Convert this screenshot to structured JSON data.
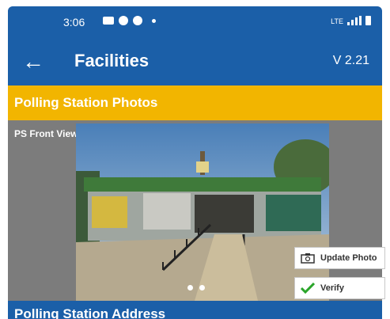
{
  "status_bar": {
    "time": "3:06",
    "network": "LTE"
  },
  "app_bar": {
    "title": "Facilities",
    "version": "V 2.21"
  },
  "section": {
    "title": "Polling Station Photos"
  },
  "photo": {
    "label": "PS Front View",
    "actions": {
      "update_label": "Update Photo",
      "verify_label": "Verify"
    },
    "carousel_pages": 2
  },
  "address_section": {
    "title": "Polling Station Address"
  },
  "colors": {
    "primary": "#1b5fa8",
    "accent": "#f2b500",
    "verify_green": "#2aa52a"
  }
}
